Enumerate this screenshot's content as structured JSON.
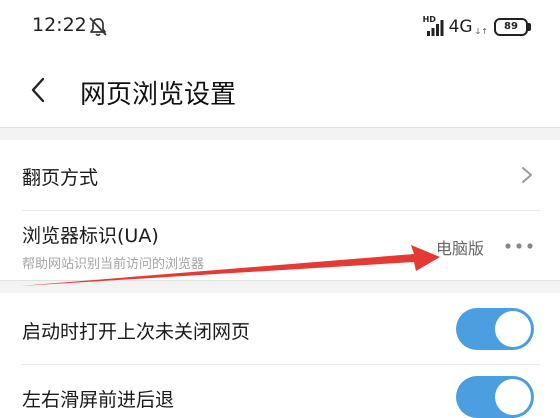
{
  "status_bar": {
    "time": "12:22",
    "hd_label": "HD",
    "network": "4G",
    "network_arrows": "↓↑",
    "battery": "89"
  },
  "header": {
    "title": "网页浏览设置"
  },
  "settings": {
    "page_turn": {
      "title": "翻页方式"
    },
    "ua": {
      "title": "浏览器标识(UA)",
      "subtitle": "帮助网站识别当前访问的浏览器",
      "value": "电脑版"
    },
    "restore_tabs": {
      "title": "启动时打开上次未关闭网页",
      "enabled": true
    },
    "swipe_nav": {
      "title": "左右滑屏前进后退",
      "enabled": true
    }
  },
  "colors": {
    "accent": "#4b9ee0",
    "annotation_arrow": "#e53935"
  },
  "icons": {
    "mute": "bell-off-icon",
    "back": "chevron-left-icon",
    "forward": "chevron-right-icon",
    "more": "more-horizontal-icon"
  }
}
